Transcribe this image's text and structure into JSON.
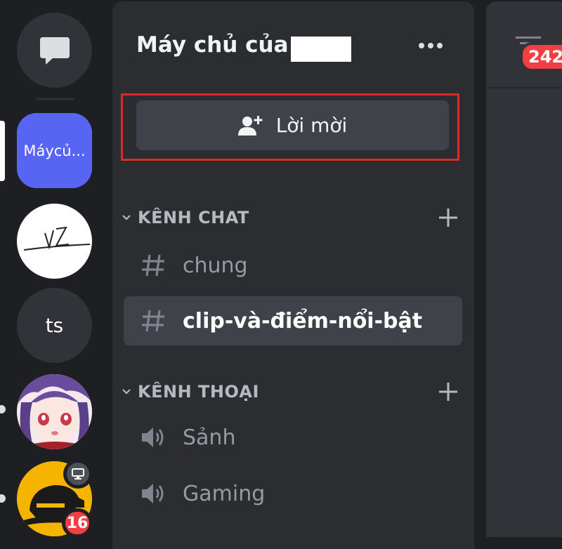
{
  "server_rail": {
    "items": [
      {
        "kind": "dm",
        "icon": "chat-bubble-icon"
      },
      {
        "kind": "server",
        "label": "Máycủ...",
        "selected": true
      },
      {
        "kind": "server",
        "name": "VZ"
      },
      {
        "kind": "server",
        "label": "ts"
      },
      {
        "kind": "server",
        "icon": "anime-avatar"
      },
      {
        "kind": "server",
        "icon": "pubg-helmet",
        "status_icon": "monitor-icon",
        "badge": "16"
      }
    ],
    "accent": "#5865f2",
    "badge_color": "#f23f43"
  },
  "server_header": {
    "title": "Máy chủ của",
    "more_icon": "more-dots-icon"
  },
  "invite_button": {
    "label": "Lời mời",
    "icon": "add-person-icon",
    "highlight_color": "#d92b2b"
  },
  "categories": [
    {
      "label": "KÊNH CHAT",
      "channels": [
        {
          "name": "chung",
          "icon": "hash-icon",
          "active": false
        },
        {
          "name": "clip-và-điểm-nổi-bật",
          "icon": "hash-icon",
          "active": true
        }
      ]
    },
    {
      "label": "KÊNH THOẠI",
      "channels": [
        {
          "name": "Sảnh",
          "icon": "speaker-icon",
          "active": false
        },
        {
          "name": "Gaming",
          "icon": "speaker-icon",
          "active": false
        }
      ]
    }
  ],
  "top_bar": {
    "threads_icon": "threads-icon",
    "badge": "242"
  }
}
